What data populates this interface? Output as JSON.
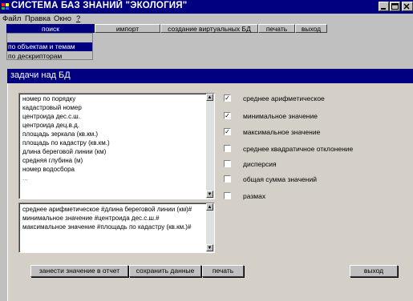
{
  "window": {
    "title": "СИСТЕМА БАЗ ЗНАНИЙ \"ЭКОЛОГИЯ\""
  },
  "menu": {
    "file": "Файл",
    "edit": "Правка",
    "window": "Окно",
    "help": "?"
  },
  "toolbar": {
    "search": "поиск",
    "import": "импорт",
    "create_virtual_db": "создание виртуальных БД",
    "print": "печать",
    "exit": "выход"
  },
  "search_menu": {
    "items": [
      "по объектам и темам",
      "по дескрипторам"
    ]
  },
  "panel": {
    "title": "задачи над  БД",
    "fields": [
      "номер по порядку",
      "кадастровый номер",
      "центроида дес.с.ш.",
      "центроида дец.в.д.",
      "площадь зеркала (кв.км.)",
      "площадь по кадастру (кв.км.)",
      "длина береговой линии (км)",
      "средняя глубина (м)",
      "номер водосбора",
      "..."
    ],
    "results": [
      "среднее арифметическое #длина береговой линии (км)#",
      "минимальное  значение #центроида дес.с.ш.#",
      "максимальное  значение #площадь по кадастру (кв.км.)#"
    ],
    "stats": [
      {
        "label": "среднее арифметическое",
        "checked": true
      },
      {
        "label": "минимальное  значение",
        "checked": true
      },
      {
        "label": "максимальное  значение",
        "checked": true
      },
      {
        "label": "среднее квадратичное отклонение",
        "checked": false
      },
      {
        "label": "дисперсия",
        "checked": false
      },
      {
        "label": "общая сумма значений",
        "checked": false
      },
      {
        "label": "размах",
        "checked": false
      }
    ],
    "buttons": {
      "add_to_report": "занести значение в отчет",
      "save_data": "сохранить данные",
      "print": "печать",
      "exit": "выход"
    }
  }
}
